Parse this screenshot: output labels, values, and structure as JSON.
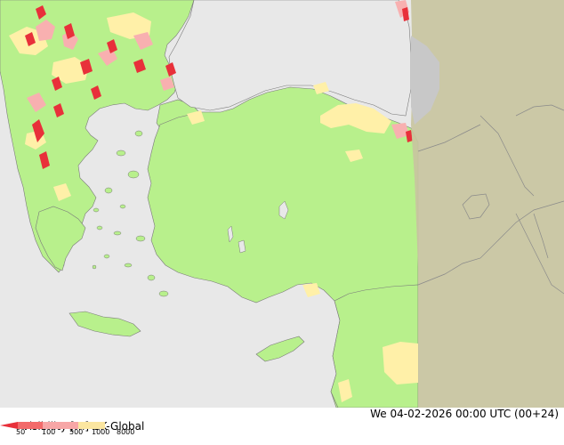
{
  "header": {
    "product": "Visibility [m]",
    "model": "UK-Global",
    "datetime": "We 04-02-2026 00:00 UTC (00+24)"
  },
  "legend": {
    "ticks": [
      "50",
      "100",
      "500",
      "1000",
      "8000"
    ],
    "colors": [
      "#e8303a",
      "#f26a6a",
      "#f7a6a6",
      "#fbe6a0"
    ]
  },
  "colors": {
    "sea": "#e8e8e8",
    "land": "#b8f08c",
    "night_overlay": "#c8c4a0",
    "haze": "#fff0a8",
    "mist": "#f8b0b0",
    "fog": "#e8303a",
    "coast": "#7a7a7a"
  }
}
